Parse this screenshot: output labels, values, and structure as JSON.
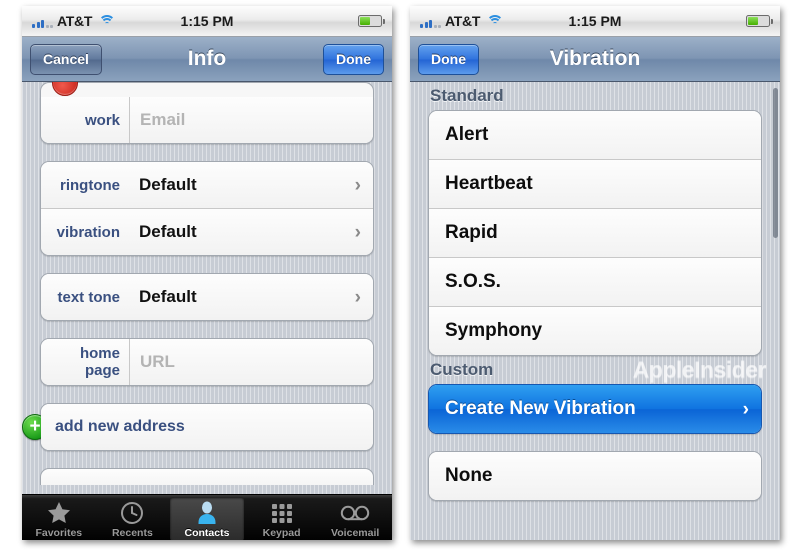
{
  "status_bar": {
    "carrier": "AT&T",
    "time": "1:15 PM",
    "signal_icon": "signal-bars-icon",
    "wifi_icon": "wifi-icon",
    "battery_icon": "battery-icon",
    "battery_level_pct": 52
  },
  "left_screen": {
    "nav": {
      "cancel_label": "Cancel",
      "title": "Info",
      "done_label": "Done"
    },
    "rows": [
      {
        "label": "work",
        "placeholder": "Email",
        "type": "field"
      },
      {
        "label": "ringtone",
        "value": "Default",
        "type": "disclosure"
      },
      {
        "label": "vibration",
        "value": "Default",
        "type": "disclosure"
      },
      {
        "label": "text tone",
        "value": "Default",
        "type": "disclosure"
      },
      {
        "label": "home page",
        "placeholder": "URL",
        "type": "field"
      },
      {
        "label": "add new address",
        "type": "add"
      }
    ],
    "add_icon": "plus-circle-icon",
    "delete_icon": "delete-minus-icon",
    "tabs": [
      {
        "label": "Favorites",
        "icon": "star-icon",
        "active": false
      },
      {
        "label": "Recents",
        "icon": "clock-icon",
        "active": false
      },
      {
        "label": "Contacts",
        "icon": "person-icon",
        "active": true
      },
      {
        "label": "Keypad",
        "icon": "keypad-grid-icon",
        "active": false
      },
      {
        "label": "Voicemail",
        "icon": "voicemail-icon",
        "active": false
      }
    ]
  },
  "right_screen": {
    "nav": {
      "done_label": "Done",
      "title": "Vibration"
    },
    "standard_header": "Standard",
    "standard_items": [
      {
        "label": "Alert"
      },
      {
        "label": "Heartbeat"
      },
      {
        "label": "Rapid"
      },
      {
        "label": "S.O.S."
      },
      {
        "label": "Symphony"
      }
    ],
    "custom_header": "Custom",
    "watermark": "AppleInsider",
    "custom_action": {
      "label": "Create New Vibration",
      "selected": true,
      "chevron": "chevron-right-icon"
    },
    "none_item": {
      "label": "None"
    }
  },
  "colors": {
    "accent_blue": "#0f73e0",
    "nav_blue": "#7e95b3",
    "label_blue": "#3a5080",
    "add_green": "#189a18",
    "battery_green": "#46b000"
  },
  "glyphs": {
    "chevron": "›"
  }
}
